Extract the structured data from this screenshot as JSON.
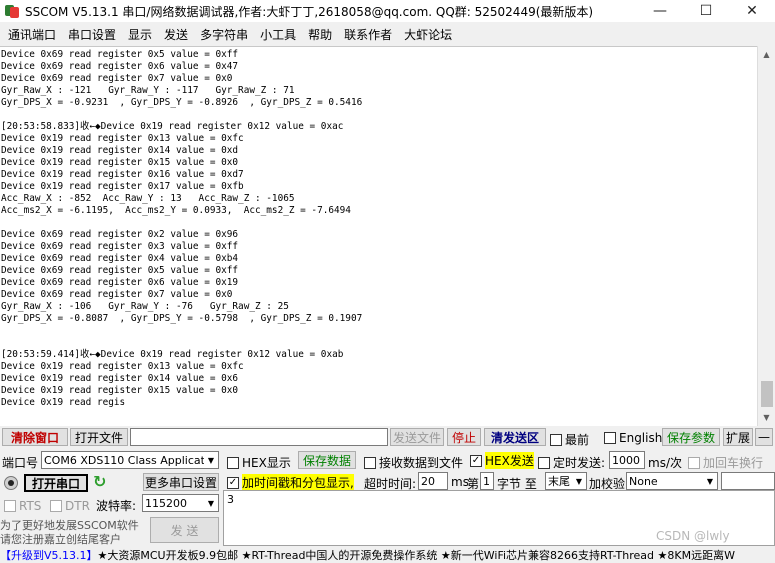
{
  "window": {
    "title": "SSCOM V5.13.1 串口/网络数据调试器,作者:大虾丁丁,2618058@qq.com. QQ群: 52502449(最新版本)",
    "minimize": "—",
    "maximize": "☐",
    "close": "✕"
  },
  "menu": [
    "通讯端口",
    "串口设置",
    "显示",
    "发送",
    "多字符串",
    "小工具",
    "帮助",
    "联系作者",
    "大虾论坛"
  ],
  "receive_lines": [
    "Device 0x69 read register 0x5 value = 0xff",
    "Device 0x69 read register 0x6 value = 0x47",
    "Device 0x69 read register 0x7 value = 0x0",
    "Gyr_Raw_X : -121   Gyr_Raw_Y : -117   Gyr_Raw_Z : 71",
    "Gyr_DPS_X = -0.9231  , Gyr_DPS_Y = -0.8926  , Gyr_DPS_Z = 0.5416",
    "",
    "[20:53:58.833]收←◆Device 0x19 read register 0x12 value = 0xac",
    "Device 0x19 read register 0x13 value = 0xfc",
    "Device 0x19 read register 0x14 value = 0xd",
    "Device 0x19 read register 0x15 value = 0x0",
    "Device 0x19 read register 0x16 value = 0xd7",
    "Device 0x19 read register 0x17 value = 0xfb",
    "Acc_Raw_X : -852  Acc_Raw_Y : 13   Acc_Raw_Z : -1065",
    "Acc_ms2_X = -6.1195,  Acc_ms2_Y = 0.0933,  Acc_ms2_Z = -7.6494",
    "",
    "Device 0x69 read register 0x2 value = 0x96",
    "Device 0x69 read register 0x3 value = 0xff",
    "Device 0x69 read register 0x4 value = 0xb4",
    "Device 0x69 read register 0x5 value = 0xff",
    "Device 0x69 read register 0x6 value = 0x19",
    "Device 0x69 read register 0x7 value = 0x0",
    "Gyr_Raw_X : -106   Gyr_Raw_Y : -76   Gyr_Raw_Z : 25",
    "Gyr_DPS_X = -0.8087  , Gyr_DPS_Y = -0.5798  , Gyr_DPS_Z = 0.1907",
    "",
    "",
    "[20:53:59.414]收←◆Device 0x19 read register 0x12 value = 0xab",
    "Device 0x19 read register 0x13 value = 0xfc",
    "Device 0x19 read register 0x14 value = 0x6",
    "Device 0x19 read register 0x15 value = 0x0",
    "Device 0x19 read regis"
  ],
  "toolbar1": {
    "clear_window": "清除窗口",
    "open_file": "打开文件",
    "send_file": "发送文件",
    "stop": "停止",
    "clear_send": "清发送区",
    "topmost": "最前",
    "english": "English",
    "save_params": "保存参数",
    "expand": "扩展",
    "collapse": "—"
  },
  "row2": {
    "port_label": "端口号",
    "port_value": "COM6 XDS110 Class Applicat",
    "hex_display": "HEX显示",
    "save_data": "保存数据",
    "recv_to_file": "接收数据到文件",
    "hex_send": "HEX发送",
    "timed_send": "定时发送:",
    "interval": "1000",
    "interval_unit": "ms/次",
    "add_crlf": "加回车换行",
    "check_mark": "✓"
  },
  "row3": {
    "open_port": "打开串口",
    "more_settings": "更多串口设置",
    "timestamp": "加时间戳和分包显示,",
    "timeout_label": "超时时间:",
    "timeout_value": "20",
    "timeout_unit": "ms",
    "nth_label": "第",
    "nth_value": "1",
    "byte_label": "字节 至",
    "end_value": "末尾",
    "checksum_label": "加校验",
    "checksum_value": "None"
  },
  "row4": {
    "rts": "RTS",
    "dtr": "DTR",
    "baud_label": "波特率:",
    "baud_value": "115200"
  },
  "promo": {
    "line1": "为了更好地发展SSCOM软件",
    "line2": "请您注册嘉立创结尾客户",
    "send": "发 送"
  },
  "send_text": "3",
  "ad_bar": {
    "upgrade": "【升级到V5.13.1】",
    "text": "★大资源MCU开发板9.9包邮 ★RT-Thread中国人的开源免费操作系统 ★新一代WiFi芯片兼容8266支持RT-Thread ★8KM远距离W"
  },
  "watermark": "CSDN @lwly"
}
